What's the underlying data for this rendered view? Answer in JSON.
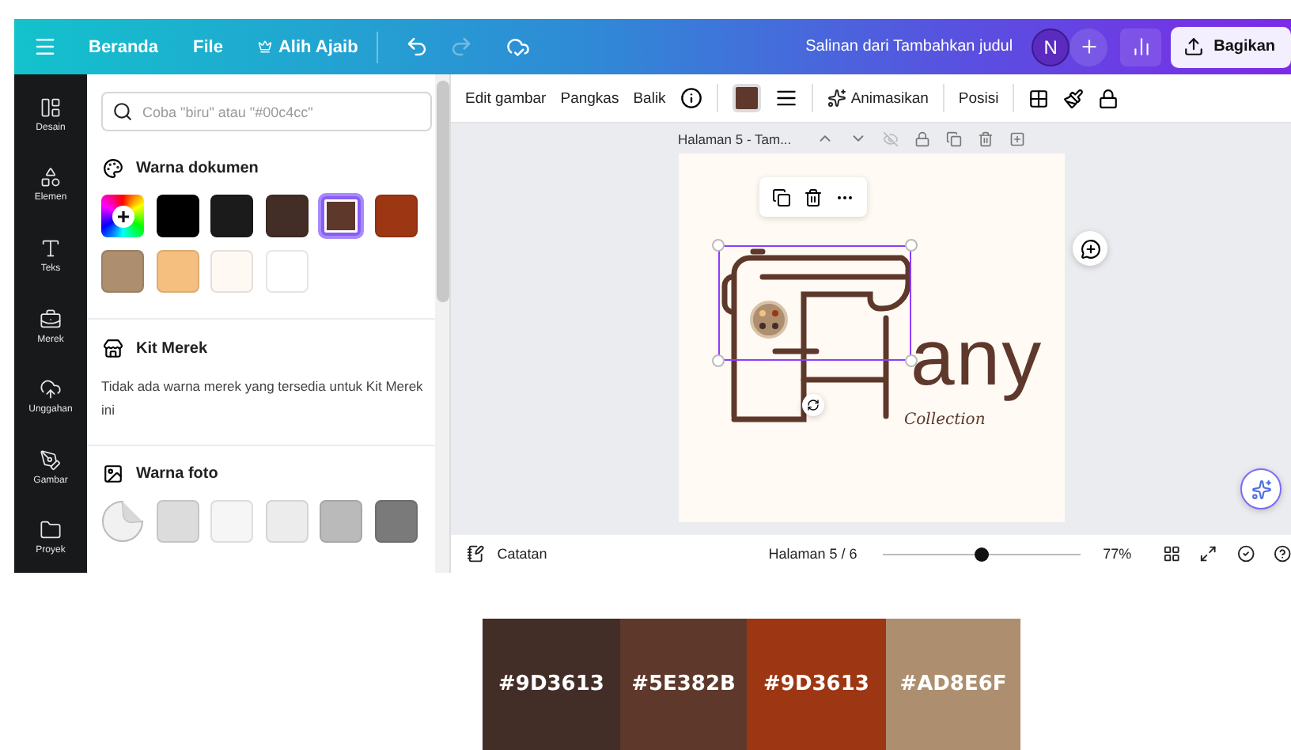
{
  "topbar": {
    "nav": [
      "Beranda",
      "File"
    ],
    "magic": "Alih Ajaib",
    "redo_disabled": true,
    "title": "Salinan dari Tambahkan judul",
    "avatar": "N",
    "share": "Bagikan"
  },
  "sidebar": {
    "items": [
      {
        "label": "Desain"
      },
      {
        "label": "Elemen"
      },
      {
        "label": "Teks"
      },
      {
        "label": "Merek"
      },
      {
        "label": "Unggahan"
      },
      {
        "label": "Gambar"
      },
      {
        "label": "Proyek"
      }
    ]
  },
  "panel": {
    "search": {
      "placeholder": "Coba \"biru\" atau \"#00c4cc\""
    },
    "document_colors": {
      "title": "Warna dokumen",
      "swatches": [
        {
          "kind": "add"
        },
        {
          "kind": "color",
          "color": "#000000",
          "selected": false
        },
        {
          "kind": "color",
          "color": "#1b1b1b",
          "selected": false
        },
        {
          "kind": "color",
          "color": "#432d27",
          "selected": false
        },
        {
          "kind": "color",
          "color": "#5e382b",
          "selected": true
        },
        {
          "kind": "color",
          "color": "#9d3613",
          "selected": false
        },
        {
          "kind": "color",
          "color": "#ad8e6f",
          "selected": false
        },
        {
          "kind": "color",
          "color": "#f5c07f",
          "selected": false
        },
        {
          "kind": "color",
          "color": "#fff9f3",
          "selected": false
        },
        {
          "kind": "color",
          "color": "#ffffff",
          "selected": false
        }
      ]
    },
    "brand_kit": {
      "title": "Kit Merek",
      "text": "Tidak ada warna merek yang tersedia untuk Kit Merek ini"
    },
    "photo_colors": {
      "title": "Warna foto",
      "swatches": [
        {
          "kind": "sticker"
        },
        {
          "kind": "color",
          "color": "#dcdcdc",
          "selected": false
        },
        {
          "kind": "color",
          "color": "#f6f6f6",
          "selected": false
        },
        {
          "kind": "color",
          "color": "#ececec",
          "selected": false
        },
        {
          "kind": "color",
          "color": "#bababa",
          "selected": false
        },
        {
          "kind": "color",
          "color": "#7a7a7a",
          "selected": false
        }
      ]
    }
  },
  "toolbar": {
    "edit": "Edit gambar",
    "crop": "Pangkas",
    "flip": "Balik",
    "fill": {
      "color": "#5e382b"
    },
    "animate": "Animasikan",
    "position": "Posisi"
  },
  "page_header": {
    "title": "Halaman 5 - Tam..."
  },
  "canvas": {
    "word": "any",
    "tagline": "Collection"
  },
  "bottom_bar": {
    "notes": "Catatan",
    "page": "Halaman 5 / 6",
    "zoom": {
      "level": 0.5,
      "reading": "77%"
    }
  },
  "palette": [
    {
      "label": "#9D3613",
      "color": "#432d27"
    },
    {
      "label": "#5E382B",
      "color": "#5e382b"
    },
    {
      "label": "#9D3613",
      "color": "#9d3613"
    },
    {
      "label": "#AD8E6F",
      "color": "#ad8e6f"
    }
  ]
}
